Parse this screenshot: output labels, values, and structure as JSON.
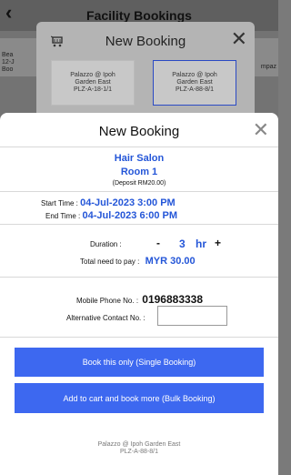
{
  "background": {
    "header_title": "Facility Bookings",
    "back_icon": "chevron-left-icon",
    "row_lines": [
      "Bea",
      "12-J",
      "Boo"
    ],
    "row_right": "mpaz"
  },
  "modal_back": {
    "title": "New Booking",
    "cart_icon": "cart-icon",
    "close_icon": "close-icon",
    "cards": [
      {
        "lines": [
          "Palazzo @ Ipoh",
          "Garden East",
          "PLZ-A-18-1/1"
        ]
      },
      {
        "lines": [
          "Palazzo @ Ipoh",
          "Garden East",
          "PLZ-A-88-8/1"
        ]
      }
    ]
  },
  "modal": {
    "title": "New Booking",
    "close_icon": "close-icon",
    "facility": "Hair Salon",
    "room": "Room 1",
    "deposit": "(Deposit RM20.00)",
    "start_label": "Start Time :",
    "start_value": "04-Jul-2023 3:00 PM",
    "end_label": "End Time :",
    "end_value": "04-Jul-2023 6:00 PM",
    "duration_label": "Duration :",
    "duration_minus": "-",
    "duration_value": "3",
    "duration_unit": "hr",
    "duration_plus": "+",
    "total_label": "Total need to pay :",
    "total_value": "MYR 30.00",
    "mobile_label": "Mobile Phone No. :",
    "mobile_value": "0196883338",
    "alt_label": "Alternative Contact No. :",
    "alt_value": "",
    "btn_single": "Book this only (Single Booking)",
    "btn_bulk": "Add to cart and book more (Bulk Booking)",
    "footer_line1": "Palazzo @ Ipoh Garden East",
    "footer_line2": "PLZ-A-88-8/1"
  },
  "colors": {
    "accent": "#2456d8",
    "button": "#3d68f0"
  }
}
